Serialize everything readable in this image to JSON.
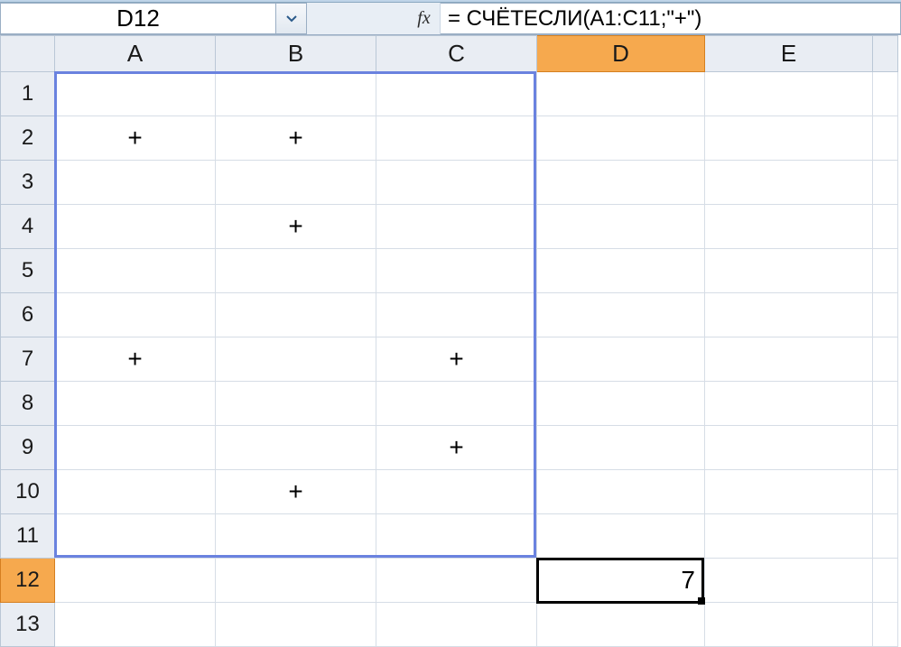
{
  "nameBox": "D12",
  "formula": "= СЧЁТЕСЛИ(A1:C11;\"+\")",
  "fxLabel": "fx",
  "columns": [
    "A",
    "B",
    "C",
    "D",
    "E"
  ],
  "activeColumn": "D",
  "activeRow": "12",
  "rowCount": 13,
  "cells": {
    "A2": "+",
    "B2": "+",
    "B4": "+",
    "A7": "+",
    "C7": "+",
    "C9": "+",
    "B10": "+",
    "D12": "7"
  },
  "chart_data": {
    "type": "table",
    "title": "Spreadsheet COUNTIF example",
    "formula_cell": "D12",
    "formula_text": "= СЧЁТЕСЛИ(A1:C11;\"+\")",
    "result": 7,
    "range": "A1:C11",
    "criterion": "+",
    "data_grid": [
      {
        "row": 1,
        "A": "",
        "B": "",
        "C": ""
      },
      {
        "row": 2,
        "A": "+",
        "B": "+",
        "C": ""
      },
      {
        "row": 3,
        "A": "",
        "B": "",
        "C": ""
      },
      {
        "row": 4,
        "A": "",
        "B": "+",
        "C": ""
      },
      {
        "row": 5,
        "A": "",
        "B": "",
        "C": ""
      },
      {
        "row": 6,
        "A": "",
        "B": "",
        "C": ""
      },
      {
        "row": 7,
        "A": "+",
        "B": "",
        "C": "+"
      },
      {
        "row": 8,
        "A": "",
        "B": "",
        "C": ""
      },
      {
        "row": 9,
        "A": "",
        "B": "",
        "C": "+"
      },
      {
        "row": 10,
        "A": "",
        "B": "+",
        "C": ""
      },
      {
        "row": 11,
        "A": "",
        "B": "",
        "C": ""
      }
    ]
  }
}
